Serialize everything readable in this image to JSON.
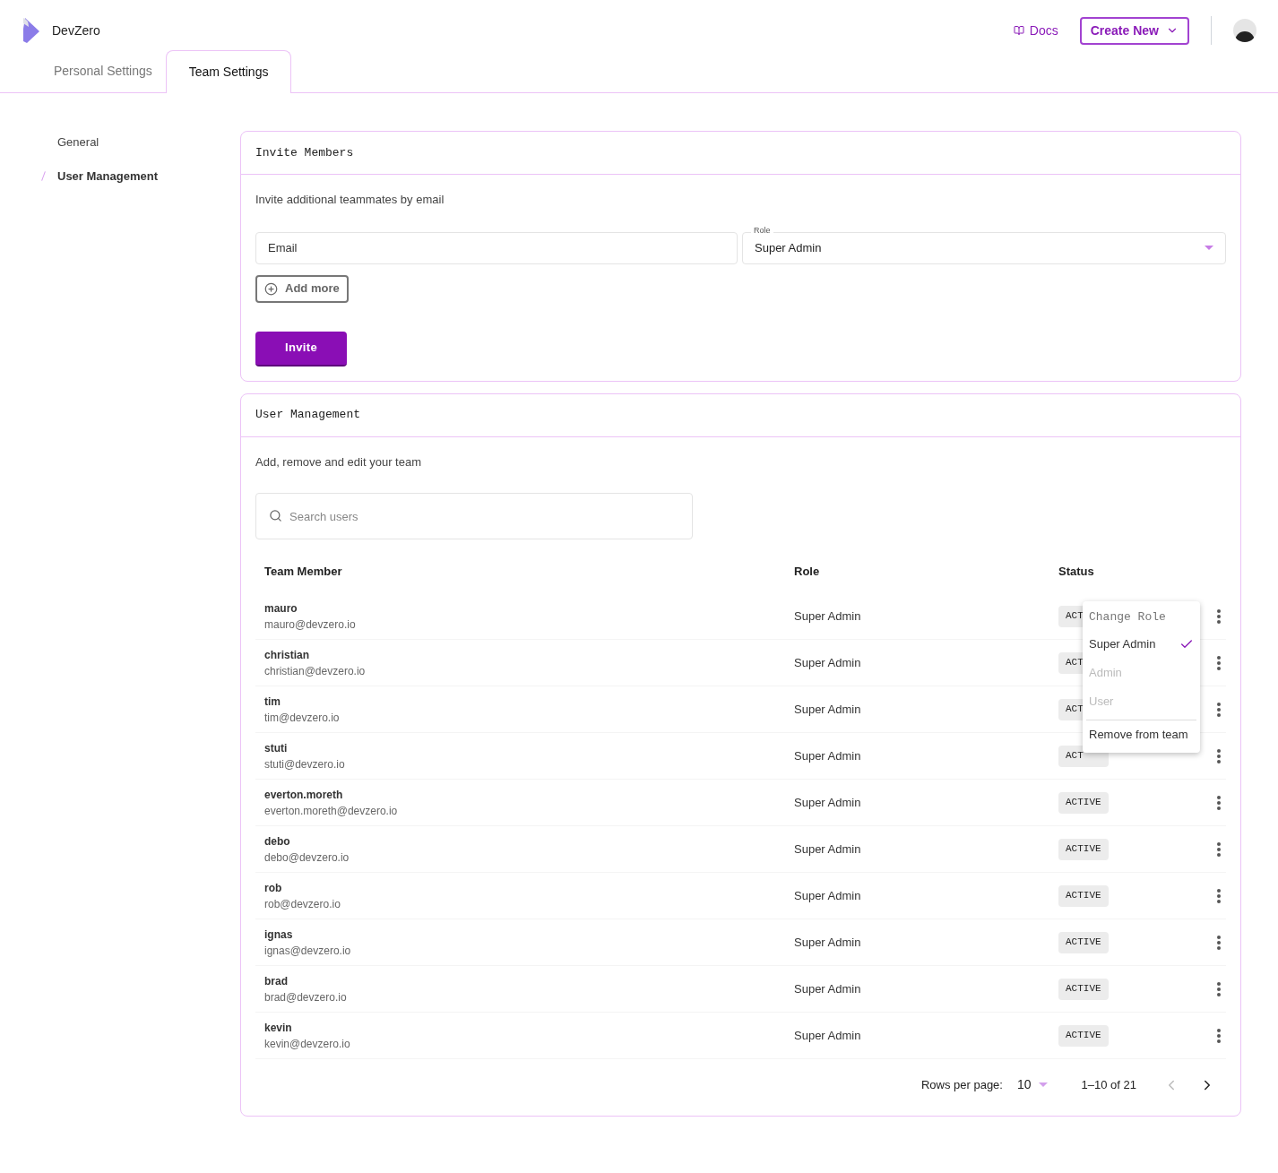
{
  "brand": {
    "name": "DevZero"
  },
  "header": {
    "docs": "Docs",
    "create_button": "Create New"
  },
  "tabs": [
    {
      "label": "Personal Settings",
      "selected": false
    },
    {
      "label": "Team Settings",
      "selected": true
    }
  ],
  "sidebar": {
    "items": [
      {
        "label": "General",
        "selected": false
      },
      {
        "label": "User Management",
        "selected": true
      }
    ]
  },
  "invite": {
    "title": "Invite Members",
    "description": "Invite additional teammates by email",
    "email": {
      "placeholder": "Email"
    },
    "role": {
      "label": "Role",
      "value": "Super Admin"
    },
    "add_more": "Add more",
    "invite_button": "Invite"
  },
  "users": {
    "title": "User Management",
    "description": "Add, remove and edit your team",
    "search": {
      "placeholder": "Search users"
    },
    "columns": [
      "Team Member",
      "Role",
      "Status"
    ],
    "rows": [
      {
        "name": "mauro",
        "email": "mauro@devzero.io",
        "role": "Super Admin",
        "status": "ACT"
      },
      {
        "name": "christian",
        "email": "christian@devzero.io",
        "role": "Super Admin",
        "status": "ACT"
      },
      {
        "name": "tim",
        "email": "tim@devzero.io",
        "role": "Super Admin",
        "status": "ACT"
      },
      {
        "name": "stuti",
        "email": "stuti@devzero.io",
        "role": "Super Admin",
        "status": "ACT"
      },
      {
        "name": "everton.moreth",
        "email": "everton.moreth@devzero.io",
        "role": "Super Admin",
        "status": "ACTIVE"
      },
      {
        "name": "debo",
        "email": "debo@devzero.io",
        "role": "Super Admin",
        "status": "ACTIVE"
      },
      {
        "name": "rob",
        "email": "rob@devzero.io",
        "role": "Super Admin",
        "status": "ACTIVE"
      },
      {
        "name": "ignas",
        "email": "ignas@devzero.io",
        "role": "Super Admin",
        "status": "ACTIVE"
      },
      {
        "name": "brad",
        "email": "brad@devzero.io",
        "role": "Super Admin",
        "status": "ACTIVE"
      },
      {
        "name": "kevin",
        "email": "kevin@devzero.io",
        "role": "Super Admin",
        "status": "ACTIVE"
      }
    ],
    "menu": {
      "title": "Change Role",
      "items": [
        {
          "label": "Super Admin",
          "selected": true,
          "disabled": false
        },
        {
          "label": "Admin",
          "selected": false,
          "disabled": true
        },
        {
          "label": "User",
          "selected": false,
          "disabled": true
        }
      ],
      "remove": "Remove from team"
    },
    "pagination": {
      "rows_label": "Rows per page:",
      "rows_value": "10",
      "range": "1–10 of 21",
      "prev_disabled": true,
      "next_disabled": false
    }
  }
}
